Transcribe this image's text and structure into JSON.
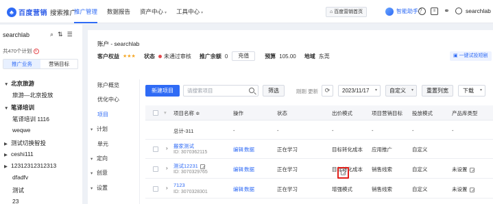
{
  "header": {
    "logo_text": "百度营销",
    "product": "搜索推广",
    "nav": [
      {
        "label": "推广管理",
        "active": true,
        "dropdown": false
      },
      {
        "label": "数据报告",
        "active": false,
        "dropdown": false
      },
      {
        "label": "资产中心",
        "active": false,
        "dropdown": true
      },
      {
        "label": "工具中心",
        "active": false,
        "dropdown": true
      }
    ],
    "home_button": "百度营销首页",
    "assistant": "智能助手",
    "help_icon": "？",
    "username": "searchlab"
  },
  "left_panel": {
    "account": "searchlab",
    "plan_count": "共470个计划",
    "tabs": [
      {
        "label": "推广业务",
        "active": true
      },
      {
        "label": "营销目标",
        "active": false
      }
    ],
    "tree": [
      {
        "label": "北京旅游",
        "level": 0,
        "expanded": true,
        "bold": true
      },
      {
        "label": "旅游—北京投放",
        "level": 1,
        "expanded": false,
        "bold": false
      },
      {
        "label": "笔译培训",
        "level": 0,
        "expanded": true,
        "bold": true
      },
      {
        "label": "笔译培训 1116",
        "level": 1,
        "expanded": false,
        "bold": false
      },
      {
        "label": "weqwe",
        "level": 1,
        "expanded": false,
        "bold": false
      },
      {
        "label": "测试切换智投",
        "level": 0,
        "expanded": false,
        "bold": false
      },
      {
        "label": "ceshi111",
        "level": 0,
        "expanded": false,
        "bold": false
      },
      {
        "label": "12312312312313",
        "level": 0,
        "expanded": false,
        "bold": false
      },
      {
        "label": "dfadfv",
        "level": 1,
        "expanded": false,
        "bold": false
      },
      {
        "label": "测试",
        "level": 1,
        "expanded": false,
        "bold": false
      },
      {
        "label": "23",
        "level": 1,
        "expanded": false,
        "bold": false
      }
    ]
  },
  "account_info": {
    "title": "账户 - searchlab",
    "rights_label": "客户权益",
    "stars": "★★★",
    "status_label": "状态",
    "status_value": "未通过审核",
    "balance_label": "推广余额",
    "balance_value": "0",
    "charge_button": "充值",
    "budget_label": "预算",
    "budget_value": "105.00",
    "region_label": "地域",
    "region_value": "东莞",
    "one_click_button": "一键试投短剧"
  },
  "content_nav": [
    {
      "label": "账户概览",
      "active": false,
      "arrow": false
    },
    {
      "label": "优化中心",
      "active": false,
      "arrow": false
    },
    {
      "label": "项目",
      "active": true,
      "arrow": false
    },
    {
      "label": "计划",
      "active": false,
      "arrow": true
    },
    {
      "label": "单元",
      "active": false,
      "arrow": false
    },
    {
      "label": "定向",
      "active": false,
      "arrow": true
    },
    {
      "label": "创意",
      "active": false,
      "arrow": true
    },
    {
      "label": "设置",
      "active": false,
      "arrow": true
    }
  ],
  "toolbar": {
    "new_button": "新建项目",
    "search_placeholder": "请搜索项目",
    "filter_button": "筛选",
    "refresh_text": "刚刚 更新",
    "date": "2023/11/17",
    "custom_button": "自定义",
    "reset_button": "重置列宽",
    "download_button": "下载"
  },
  "table": {
    "columns": [
      "项目名称 ≑",
      "操作",
      "状态",
      "出价模式",
      "项目营销目标",
      "投放模式",
      "产品库类型"
    ],
    "total_row": {
      "name": "总计-311",
      "cells": [
        "-",
        "-",
        "-",
        "-",
        "-",
        "-"
      ]
    },
    "rows": [
      {
        "name": "搬家测试",
        "id": "ID: 3070362115",
        "edit": "编辑",
        "data": "数据",
        "status": "正在学习",
        "bid": "目标转化成本",
        "goal": "应用推广",
        "mode": "自定义",
        "product_type": ""
      },
      {
        "name": "测试12231",
        "id": "ID: 3070329765",
        "edit": "编辑",
        "data": "数据",
        "status": "正在学习",
        "bid": "目标转化成本",
        "goal": "销售线索",
        "mode": "自定义",
        "product_type": "未设置"
      },
      {
        "name": "7123",
        "id": "ID: 3070328301",
        "edit": "编辑",
        "data": "数据",
        "status": "正在学习",
        "bid": "增强模式",
        "goal": "销售线索",
        "mode": "自定义",
        "product_type": "未设置"
      }
    ]
  },
  "colors": {
    "accent": "#2f6bf5",
    "warning": "#e5484d",
    "star": "#f5a623",
    "highlight_box": "#e0201a"
  }
}
